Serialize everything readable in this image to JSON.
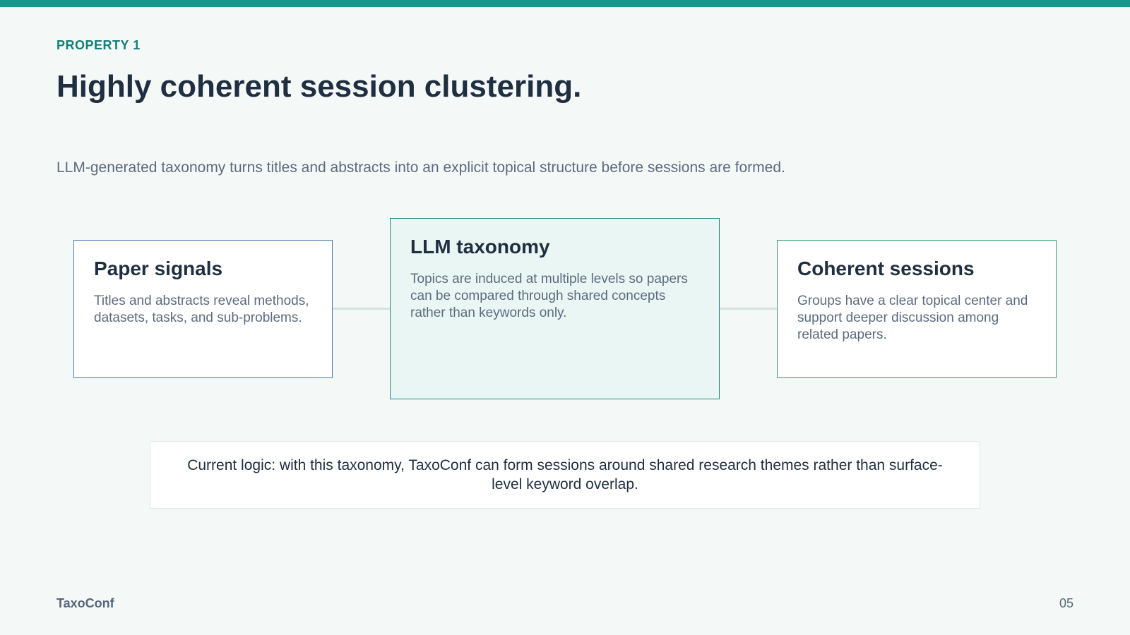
{
  "kicker": "PROPERTY 1",
  "title": "Highly coherent session clustering.",
  "subtitle": "LLM-generated taxonomy turns titles and abstracts into an explicit topical structure before sessions are formed.",
  "diagram": {
    "nodes": [
      {
        "title": "Paper signals",
        "body": "Titles and abstracts reveal methods, datasets, tasks, and sub-problems.",
        "border_color": "#4a77b8"
      },
      {
        "title": "LLM taxonomy",
        "body": "Topics are induced at multiple levels so papers can be compared through shared concepts rather than keywords only.",
        "border_color": "#1e8b80"
      },
      {
        "title": "Coherent sessions",
        "body": "Groups have a clear topical center and support deeper discussion among related papers.",
        "border_color": "#3f9a6c"
      }
    ]
  },
  "logic_note": "Current logic: with this taxonomy, TaxoConf can form sessions around shared research themes rather than surface-level keyword overlap.",
  "footer": {
    "brand": "TaxoConf",
    "page": "05"
  },
  "colors": {
    "accent": "#15998c",
    "background": "#f4f9f8",
    "heading": "#1f2e40",
    "muted": "#5b6b7f"
  }
}
